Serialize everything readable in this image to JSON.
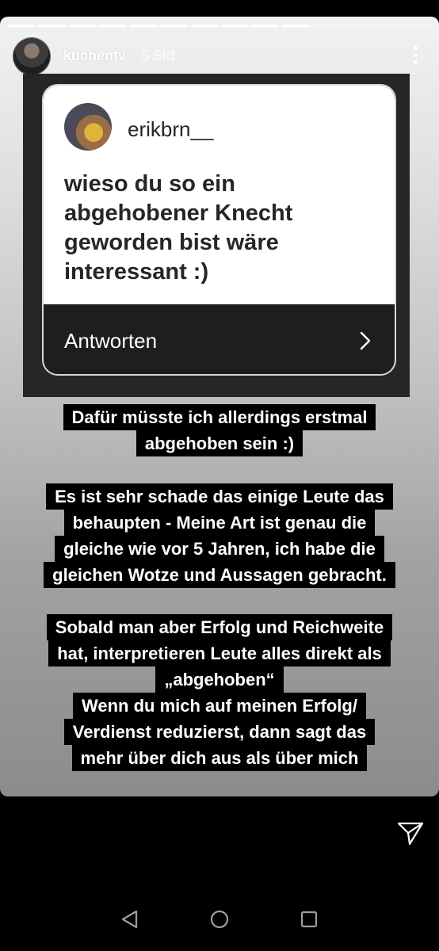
{
  "story": {
    "progress_total": 14,
    "progress_done": 10,
    "username": "kuchentv",
    "time": "5 Std.",
    "more_icon": "more-vertical-icon"
  },
  "question_card": {
    "asker": "erikbrn__",
    "question": "wieso du so ein abgehobener Knecht geworden bist wäre interessant :)",
    "reply_label": "Antworten",
    "reply_icon": "chevron-right-icon"
  },
  "captions": [
    [
      "Dafür müsste ich allerdings erstmal",
      "abgehoben sein :)"
    ],
    [
      "Es ist sehr schade das einige Leute das",
      "behaupten - Meine Art ist genau die",
      "gleiche wie vor 5 Jahren, ich habe die",
      "gleichen Wotze und Aussagen gebracht."
    ],
    [
      "Sobald man aber Erfolg und Reichweite",
      "hat, interpretieren Leute alles direkt als",
      "„abgehoben“",
      "Wenn du mich auf meinen Erfolg/",
      "Verdienst reduzierst, dann sagt das",
      "mehr über dich aus als über mich"
    ]
  ],
  "footer": {
    "share_icon": "send-icon"
  },
  "nav": {
    "back_icon": "back-triangle-icon",
    "home_icon": "home-circle-icon",
    "recent_icon": "recent-apps-icon"
  },
  "colors": {
    "caption_bg": "#000000",
    "caption_text": "#ffffff",
    "card_dark": "#1e1e1e"
  }
}
